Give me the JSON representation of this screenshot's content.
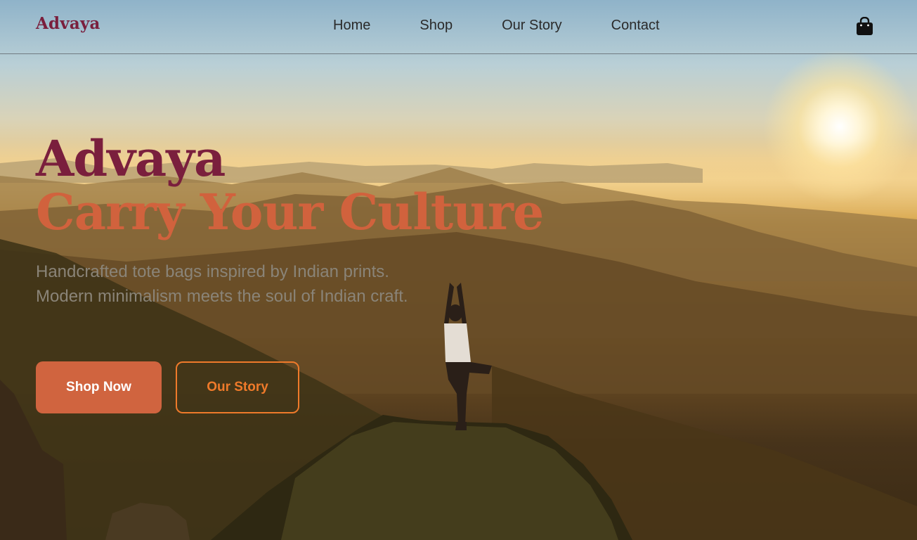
{
  "brand": {
    "logo": "Advaya"
  },
  "nav": {
    "links": [
      {
        "label": "Home"
      },
      {
        "label": "Shop"
      },
      {
        "label": "Our Story"
      },
      {
        "label": "Contact"
      }
    ],
    "cart_icon": "shopping-bag-icon"
  },
  "hero": {
    "title": "Advaya",
    "tagline": "Carry Your Culture",
    "description": "Handcrafted tote bags inspired by Indian prints. Modern minimalism meets the soul of Indian craft.",
    "primary_button": "Shop Now",
    "secondary_button": "Our Story",
    "background": "mountain-sunrise-yoga-photo"
  },
  "colors": {
    "brand_maroon": "#7a1f3d",
    "accent_terracotta": "#d0643f",
    "outline_orange": "#ef7a2a",
    "muted_text": "#8a8478"
  }
}
